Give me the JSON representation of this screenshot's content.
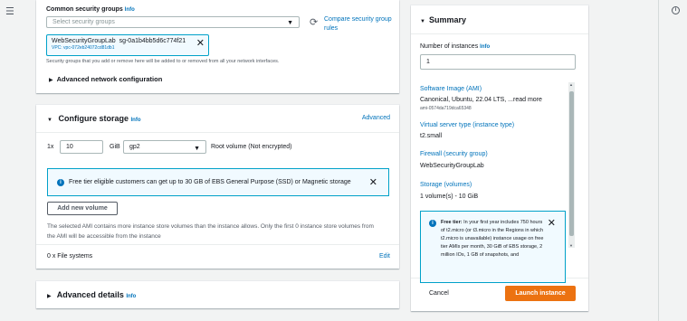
{
  "network": {
    "sg_label": "Common security groups",
    "sg_info": "Info",
    "sg_placeholder": "Select security groups",
    "compare_label": "Compare security group rules",
    "token_name": "WebSecurityGroupLab",
    "token_id": "sg-0a1b4bb5d6c774f21",
    "token_vpc": "VPC: vpc-072eb24072cd81db1",
    "help_text": "Security groups that you add or remove here will be added to or removed from all your network interfaces.",
    "advanced_network": "Advanced network configuration"
  },
  "storage": {
    "title": "Configure storage",
    "info": "Info",
    "advanced": "Advanced",
    "prefix": "1x",
    "size": "10",
    "unit": "GiB",
    "volume_type": "gp2",
    "root_volume": "Root volume  (Not encrypted)",
    "free_tier_alert": "Free tier eligible customers can get up to 30 GB of EBS General Purpose (SSD) or Magnetic storage",
    "add_volume": "Add new volume",
    "instance_store_note": "The selected AMI contains more instance store volumes than the instance allows. Only the first 0 instance store volumes from the AMI will be accessible from the instance",
    "file_systems": "0 x File systems",
    "edit": "Edit"
  },
  "advanced_details": {
    "title": "Advanced details",
    "info": "Info"
  },
  "summary": {
    "title": "Summary",
    "instances_label": "Number of instances",
    "instances_info": "Info",
    "instances_value": "1",
    "ami_label": "Software Image (AMI)",
    "ami_value": "Canonical, Ubuntu, 22.04 LTS, ...read more",
    "ami_id": "ami-0574da719dca65348",
    "type_label": "Virtual server type (instance type)",
    "type_value": "t2.small",
    "firewall_label": "Firewall (security group)",
    "firewall_value": "WebSecurityGroupLab",
    "storage_label": "Storage (volumes)",
    "storage_value": "1 volume(s) - 10 GiB",
    "tip_bold": "Free tier:",
    "tip_text": " In your first year includes 750 hours of t2.micro (or t3.micro in the Regions in which t2.micro is unavailable) instance usage on free tier AMIs per month, 30 GiB of EBS storage, 2 million IOs, 1 GB of snapshots, and",
    "cancel": "Cancel",
    "launch": "Launch instance"
  }
}
